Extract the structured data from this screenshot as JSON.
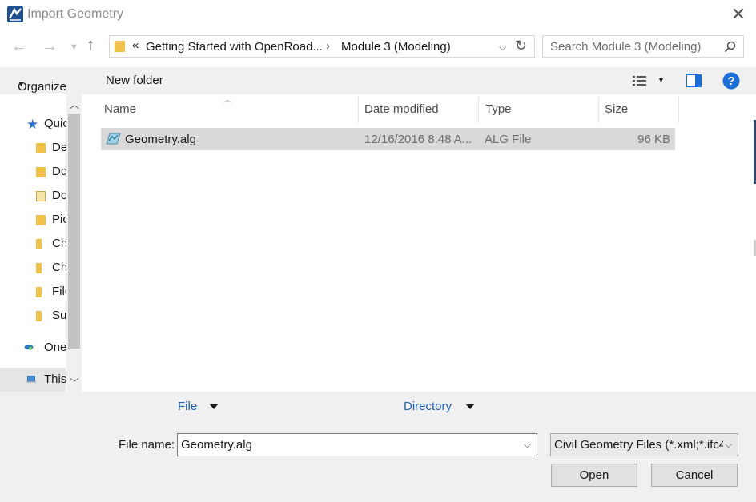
{
  "window": {
    "title": "Import Geometry"
  },
  "address": {
    "overflow": "«",
    "crumbs": [
      "Getting Started with OpenRoad...",
      "Module 3 (Modeling)"
    ]
  },
  "search": {
    "placeholder": "Search Module 3 (Modeling)"
  },
  "toolbar": {
    "organize": "Organize",
    "new_folder": "New folder"
  },
  "sidebar": {
    "items": [
      {
        "label": "Quic",
        "icon": "star-icon"
      },
      {
        "label": "De",
        "icon": "desktop-folder-icon"
      },
      {
        "label": "Do",
        "icon": "downloads-folder-icon"
      },
      {
        "label": "Do",
        "icon": "documents-folder-icon"
      },
      {
        "label": "Pic",
        "icon": "pictures-folder-icon"
      },
      {
        "label": "Ch",
        "icon": "folder-icon"
      },
      {
        "label": "Ch",
        "icon": "folder-icon"
      },
      {
        "label": "File",
        "icon": "folder-icon"
      },
      {
        "label": "Su",
        "icon": "folder-icon"
      },
      {
        "label": "One",
        "icon": "onedrive-cloud-icon"
      },
      {
        "label": "This",
        "icon": "computer-icon"
      }
    ]
  },
  "columns": {
    "name": "Name",
    "date": "Date modified",
    "type": "Type",
    "size": "Size"
  },
  "files": [
    {
      "name": "Geometry.alg",
      "date": "12/16/2016 8:48 A...",
      "type": "ALG File",
      "size": "96 KB"
    }
  ],
  "bottom": {
    "file_tab": "File",
    "directory_tab": "Directory",
    "file_name_label": "File name:",
    "file_name_value": "Geometry.alg",
    "file_type_value": "Civil Geometry Files (*.xml;*.ifc4",
    "open": "Open",
    "cancel": "Cancel"
  },
  "colors": {
    "accent": "#1f5fb8",
    "help": "#1a6fd6",
    "folder": "#f2c14a",
    "selection": "#d9d9d9"
  }
}
